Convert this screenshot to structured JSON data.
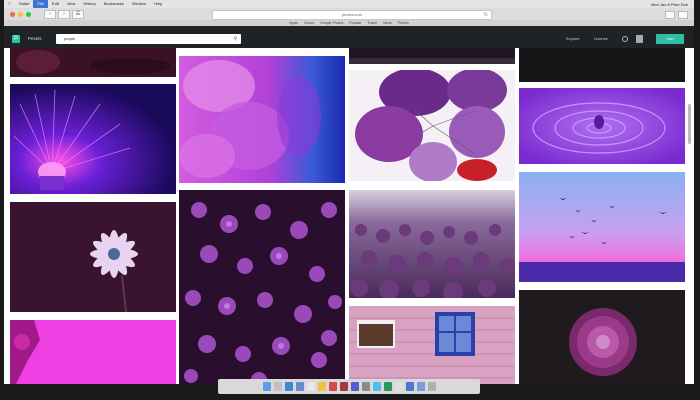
{
  "menubar": {
    "items": [
      "Safari",
      "File",
      "Edit",
      "View",
      "History",
      "Bookmarks",
      "Window",
      "Help"
    ],
    "active_index": 1,
    "right_text": "Mon Jan 8  Pixie Doe"
  },
  "browser": {
    "url": "pexels.com",
    "bookmarks": [
      "Apple",
      "iCloud",
      "Google Photos",
      "Popular",
      "Travel",
      "News",
      "Photos"
    ]
  },
  "site": {
    "brand": "Pexels",
    "search_value": "purple",
    "explore_label": "Explore",
    "license_label": "License",
    "join_label": "Join"
  },
  "colors": {
    "accent": "#2fc0a3",
    "header_bg": "#1f2326",
    "dot_red": "#ff5f57",
    "dot_yellow": "#febc2e",
    "dot_green": "#28c840"
  },
  "gallery": {
    "tiles": [
      {
        "name": "photo-dark-purple-strip"
      },
      {
        "name": "photo-fiber-optic-lamp"
      },
      {
        "name": "photo-purple-daisy"
      },
      {
        "name": "photo-magenta-flower-corner"
      },
      {
        "name": "photo-purple-petals-closeup"
      },
      {
        "name": "photo-purple-flower-cluster"
      },
      {
        "name": "photo-dark-top-strip"
      },
      {
        "name": "photo-purple-balloons"
      },
      {
        "name": "photo-purple-flower-field"
      },
      {
        "name": "photo-pink-wooden-house"
      },
      {
        "name": "photo-dark-top-strip-right"
      },
      {
        "name": "photo-purple-water-drop"
      },
      {
        "name": "photo-purple-sky-birds"
      },
      {
        "name": "photo-purple-chrysanthemum"
      }
    ]
  }
}
